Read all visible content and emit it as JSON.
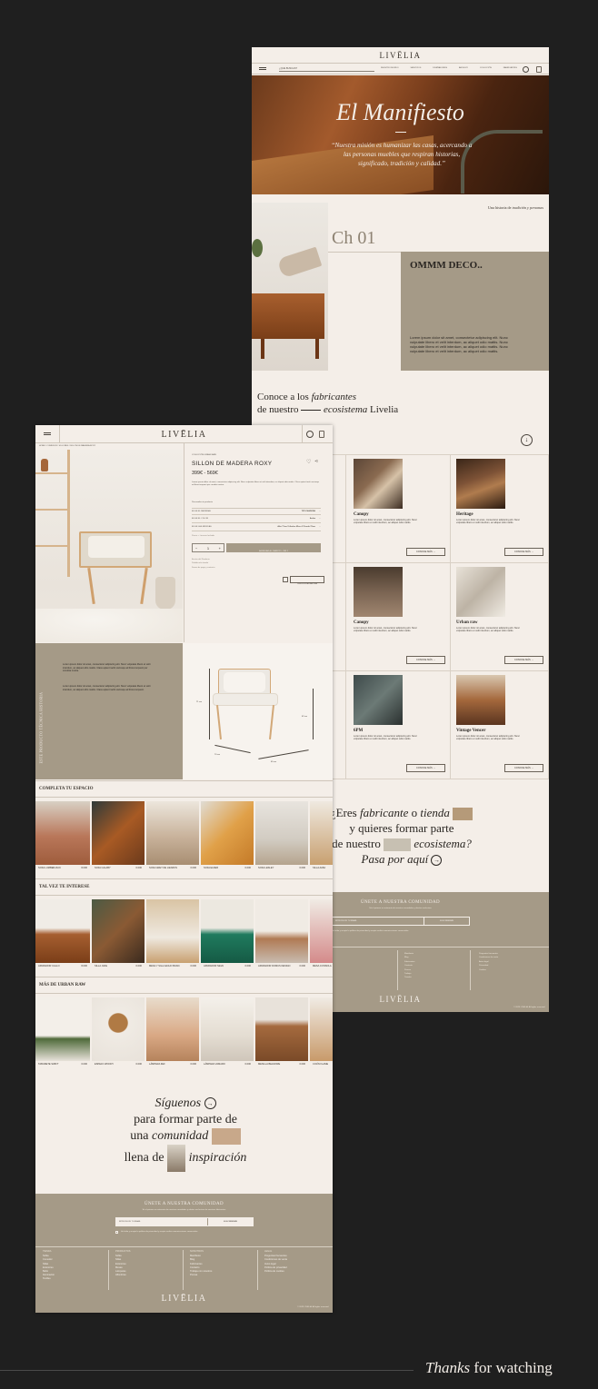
{
  "brand": {
    "logo": "LIVĒLIA"
  },
  "right_page": {
    "nav": {
      "search_label": "¿QUE BUSCAS?",
      "items": [
        "NUESTRO MUNDO",
        "SERVICIOS",
        "DISEÑADORES",
        "ARCHIVO",
        "COLECCIÓN",
        "FABRICANTES"
      ]
    },
    "hero": {
      "title": "El Manifiesto",
      "quote": "“Nuestra misión es humanizar las casas, acercando a las personas muebles que respiran historias, significado, tradición y calidad.”"
    },
    "story": {
      "kicker_a": "Una historia de ",
      "kicker_b": "tradición y personas",
      "chapter": "Ch 01",
      "box_title": "OMMM DECO..",
      "box_text": "Lorem ipsum dolor sit amet, consectetur adipiscing elit. Nunc vulputate libero et velit interdum, ac aliquet odio mattis. Nunc vulputate libero et velit interdum, ac aliquet odio mattis. Nunc vulputate libero et velit interdum, ac aliquet odio mattis."
    },
    "makers": {
      "line1_a": "Conoce a los ",
      "line1_b": "fabricantes",
      "line2_a": "de nuestro ",
      "line2_b": "ecosistema",
      "line2_c": " Livelia",
      "cards": [
        {
          "name": "Canopy",
          "text": "Lorem ipsum dolor sit amet, consectetur adipiscing elit. Nunc vulputate libero et velit interdum, ac aliquet odio mattis.",
          "cta": "CONOCE MÁS"
        },
        {
          "name": "Heritage",
          "text": "Lorem ipsum dolor sit amet, consectetur adipiscing elit. Nunc vulputate libero et velit interdum, ac aliquet odio mattis.",
          "cta": "CONOCE MÁS"
        },
        {
          "name": "Canopy",
          "text": "Lorem ipsum dolor sit amet, consectetur adipiscing elit. Nunc vulputate libero et velit interdum, ac aliquet odio mattis.",
          "cta": "CONOCE MÁS"
        },
        {
          "name": "Urban raw",
          "text": "Lorem ipsum dolor sit amet, consectetur adipiscing elit. Nunc vulputate libero et velit interdum, ac aliquet odio mattis.",
          "cta": "CONOCE MÁS"
        },
        {
          "name": "6PM",
          "text": "Lorem ipsum dolor sit amet, consectetur adipiscing elit. Nunc vulputate libero et velit interdum, ac aliquet odio mattis.",
          "cta": "CONOCE MÁS"
        },
        {
          "name": "Vintage Vencer",
          "text": "Lorem ipsum dolor sit amet, consectetur adipiscing elit. Nunc vulputate libero et velit interdum, ac aliquet odio mattis.",
          "cta": "CONOCE MÁS"
        }
      ]
    },
    "cta_block": {
      "l1_a": "¿Eres ",
      "l1_b": "fabricante",
      "l1_c": " o ",
      "l1_d": "tienda",
      "l2": "y quieres formar parte",
      "l3_a": "de nuestro ",
      "l3_b": "ecosistema?",
      "l4": "Pasa por aquí"
    },
    "newsletter": {
      "title": "ÚNETE A NUESTRA COMUNIDAD",
      "sub": "Sé el primero en enterarte de nuestras novedades y ofertas exclusivas",
      "placeholder": "INTRODUCE TU EMAIL",
      "button": "SUSCRIBIRME",
      "consent": "He leído y acepto la política de privacidad y acepto recibir comunicaciones comerciales"
    },
    "footer": {
      "logo": "LIVĒLIA",
      "copyright": "© 2023 LIVELIA. All rights reserved."
    }
  },
  "left_page": {
    "breadcrumb": "HOME / COMEDOR / SILLONES / SILLON DE MADERA ROXY",
    "product": {
      "collection": "COLECCIÓN URBAN RAW",
      "name": "SILLON DE MADERA ROXY",
      "price": "399€ - 569€",
      "desc": "Lorem ipsum dolor sit amet, consectetur adipiscing elit. Nunc vulputate libero et velit interdum, ac aliquet odio mattis. Class aptent taciti sociosqu ad litora torquent per conubia nostra.",
      "personalize": "Personaliza tu producto",
      "options": [
        {
          "label": "ELIGE EL MATERIAL",
          "value": "TIPO MADERA"
        },
        {
          "label": "ELIGE EL COLOR",
          "value": "Amba"
        },
        {
          "label": "ELIGE LAS MEDIDAS",
          "value": "Alto 71cm X Ancho 65cm X Fondo 70cm"
        }
      ],
      "warranty": "Precio + Licencia Incluido",
      "qty": "1",
      "add_to_cart": "AGREGAR AL CARRITO - 399 €",
      "links": [
        "Envíos del Producto",
        "Pedido más tienda",
        "Forma de pago y contacto"
      ],
      "ask": "PREGUNTAR AHORA"
    },
    "tech": {
      "vertical_label": "ESTE PRODUCTO TÉCNICA HISTORIA",
      "p1": "Lorem ipsum dolor sit amet, consectetur adipiscing elit. Nunc vulputate libero et velit interdum, ac aliquet odio mattis. Class aptent taciti sociosqu ad litora torquent per conubia nostra.",
      "p2": "Lorem ipsum dolor sit amet, consectetur adipiscing elit. Nunc vulputate libero et velit interdum, ac aliquet odio mattis. Class aptent taciti sociosqu ad litora torquent.",
      "dim_h": "71 cm",
      "dim_d": "70 cm",
      "dim_w": "65 cm",
      "dim_s": "62 cm"
    },
    "sections": [
      {
        "title": "COMPLETA TU ESPACIO",
        "items": [
          {
            "name": "SOFA LUMBERJACK",
            "price": "€.000"
          },
          {
            "name": "SOFA CALABY",
            "price": "0.000"
          },
          {
            "name": "SOFA GREY DE LIENZOS",
            "price": "0.000"
          },
          {
            "name": "SOFA ELDER",
            "price": "0.000"
          },
          {
            "name": "SOFA LESLEY",
            "price": "0.000"
          },
          {
            "name": "SILLA ALBA",
            "price": ""
          }
        ]
      },
      {
        "title": "TAL VEZ TE INTERESE",
        "items": [
          {
            "name": "APARADOR CALLO",
            "price": "€.000"
          },
          {
            "name": "SILLA JAKE",
            "price": "0.000"
          },
          {
            "name": "MESA Y SILLA ECHO BASIC",
            "price": "0.000"
          },
          {
            "name": "APARADOR NEVA",
            "price": "0.000"
          },
          {
            "name": "APARADOR DOMUS DESIGN",
            "price": "0.000"
          },
          {
            "name": "MESA CONSOLA",
            "price": ""
          }
        ]
      },
      {
        "title": "MÁS DE URBAN RAW",
        "items": [
          {
            "name": "TABURETE SWIFT",
            "price": "0.000"
          },
          {
            "name": "ESPEJO WOODY",
            "price": "0.000"
          },
          {
            "name": "LÁMPARA ZEF",
            "price": "0.000"
          },
          {
            "name": "LÁMPARA VAMARO",
            "price": "0.000"
          },
          {
            "name": "MESILLA BELMORE",
            "price": "0.000"
          },
          {
            "name": "COJÍN FLAME",
            "price": ""
          }
        ]
      }
    ],
    "social": {
      "l1": "Síguenos",
      "l2": "para formar parte de",
      "l3_a": "una ",
      "l3_b": "comunidad",
      "l4_a": "llena de ",
      "l4_b": "inspiración"
    },
    "newsletter": {
      "title": "ÚNETE A NUESTRA COMUNIDAD",
      "sub": "Sé el primero en enterarte de nuestras novedades y ofertas exclusivas de nuestros fabricantes",
      "placeholder": "INTRODUCE TU EMAIL",
      "button": "SUSCRIBIRME",
      "consent": "He leído y acepto la política de privacidad y acepto recibir comunicaciones comerciales"
    },
    "footer": {
      "cols": [
        {
          "title": "TIENDA",
          "items": [
            "Sofás",
            "Comedor",
            "Sillas",
            "Exteriores",
            "Baño",
            "Iluminación",
            "Textiles"
          ]
        },
        {
          "title": "PRODUCTOS",
          "items": [
            "Sofás",
            "Sillas",
            "Exteriores",
            "Mesas",
            "Lámparas",
            "Alfombras"
          ]
        },
        {
          "title": "NOSOTROS",
          "items": [
            "Manifiesto",
            "Blog",
            "Fabricantes",
            "Contacto",
            "Trabaja con nosotros",
            "Prensa"
          ]
        },
        {
          "title": "LEGAL",
          "items": [
            "Preguntas frecuentes",
            "Condiciones de venta",
            "Aviso legal",
            "Política de privacidad",
            "Política de cookies"
          ]
        }
      ],
      "logo": "LIVĒLIA",
      "copyright": "© 2023 LIVELIA. All rights reserved."
    }
  },
  "closing": {
    "a": "Thanks",
    "b": " for watching"
  }
}
